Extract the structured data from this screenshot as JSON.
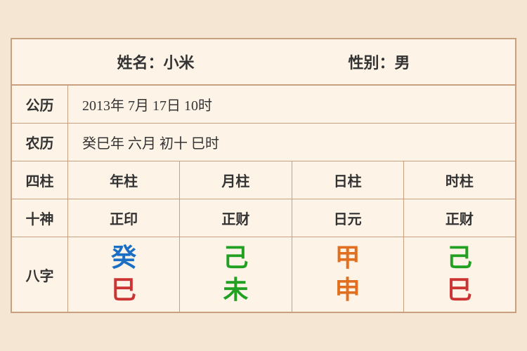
{
  "header": {
    "name_label": "姓名：小米",
    "gender_label": "性别：男"
  },
  "rows": {
    "gong_li_label": "公历",
    "gong_li_value": "2013年 7月 17日 10时",
    "nong_li_label": "农历",
    "nong_li_value": "癸巳年 六月 初十 巳时"
  },
  "table": {
    "col_header_label": "四柱",
    "col_headers": [
      "年柱",
      "月柱",
      "日柱",
      "时柱"
    ],
    "shishen_label": "十神",
    "shishen_values": [
      "正印",
      "正财",
      "日元",
      "正财"
    ],
    "bazi_label": "八字",
    "bazi_tian": [
      {
        "char": "癸",
        "color": "blue"
      },
      {
        "char": "己",
        "color": "green"
      },
      {
        "char": "甲",
        "color": "orange"
      },
      {
        "char": "己",
        "color": "green"
      }
    ],
    "bazi_di": [
      {
        "char": "巳",
        "color": "red"
      },
      {
        "char": "未",
        "color": "green"
      },
      {
        "char": "申",
        "color": "orange"
      },
      {
        "char": "巳",
        "color": "red"
      }
    ]
  }
}
